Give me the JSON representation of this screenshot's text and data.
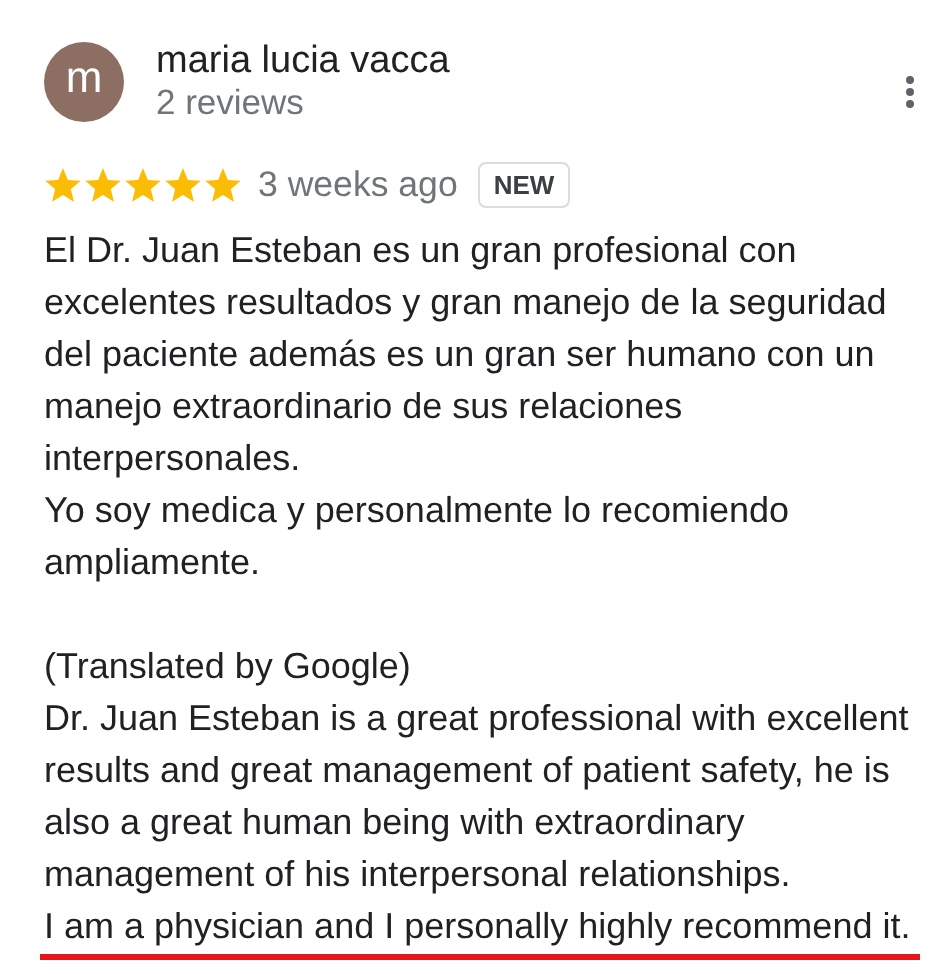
{
  "review": {
    "avatar_letter": "m",
    "author": "maria lucia vacca",
    "meta": "2 reviews",
    "stars": 5,
    "time": "3 weeks ago",
    "badge": "NEW",
    "paragraphs": [
      {
        "text": "El Dr. Juan Esteban es un gran profesional con\nexcelentes resultados y gran manejo de la seguridad\ndel paciente además es un gran ser humano con un\nmanejo extraordinario de sus relaciones\ninterpersonales.\nYo soy medica y personalmente lo recomiendo\nampliamente.",
        "underlined": false
      },
      {
        "text": "(Translated by Google)\nDr. Juan Esteban is a great professional with excellent\nresults and great management of patient safety, he is\nalso a great human being with extraordinary\nmanagement of his interpersonal relationships.",
        "underlined": false
      },
      {
        "text": "I am a physician and I personally highly recommend it.",
        "underlined": true
      }
    ]
  }
}
